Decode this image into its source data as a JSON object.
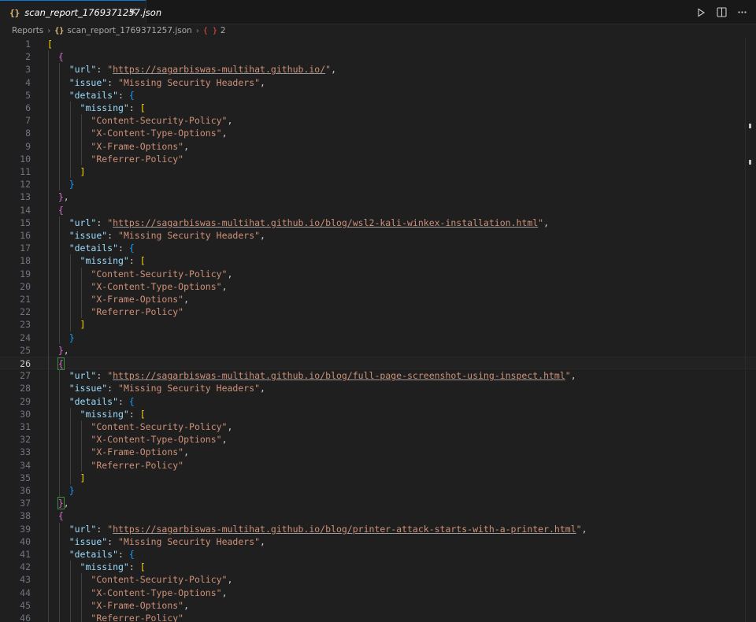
{
  "tab": {
    "icon": "{}",
    "title": "scan_report_1769371257.json",
    "close_glyph": "✕"
  },
  "breadcrumb": {
    "folder": "Reports",
    "file_icon": "{}",
    "file": "scan_report_1769371257.json",
    "symbol_icon": "{ }",
    "symbol": "2"
  },
  "editor": {
    "active_line": 26,
    "colors": {
      "key": "#9cdcfe",
      "string": "#ce9178",
      "bracket_level0": "#ffd700",
      "bracket_level1": "#da70d6",
      "bracket_level2": "#179fff"
    },
    "entries": [
      {
        "url": "https://sagarbiswas-multihat.github.io/",
        "issue": "Missing Security Headers",
        "missing": [
          "Content-Security-Policy",
          "X-Content-Type-Options",
          "X-Frame-Options",
          "Referrer-Policy"
        ]
      },
      {
        "url": "https://sagarbiswas-multihat.github.io/blog/wsl2-kali-winkex-installation.html",
        "issue": "Missing Security Headers",
        "missing": [
          "Content-Security-Policy",
          "X-Content-Type-Options",
          "X-Frame-Options",
          "Referrer-Policy"
        ]
      },
      {
        "url": "https://sagarbiswas-multihat.github.io/blog/full-page-screenshot-using-inspect.html",
        "issue": "Missing Security Headers",
        "missing": [
          "Content-Security-Policy",
          "X-Content-Type-Options",
          "X-Frame-Options",
          "Referrer-Policy"
        ]
      },
      {
        "url": "https://sagarbiswas-multihat.github.io/blog/printer-attack-starts-with-a-printer.html",
        "issue": "Missing Security Headers",
        "missing": [
          "Content-Security-Policy",
          "X-Content-Type-Options",
          "X-Frame-Options",
          "Referrer-Policy"
        ]
      }
    ]
  },
  "icons": [
    "json-file-icon",
    "close-icon",
    "run-icon",
    "split-editor-icon",
    "more-actions-icon",
    "chevron-right-icon",
    "object-symbol-icon"
  ]
}
